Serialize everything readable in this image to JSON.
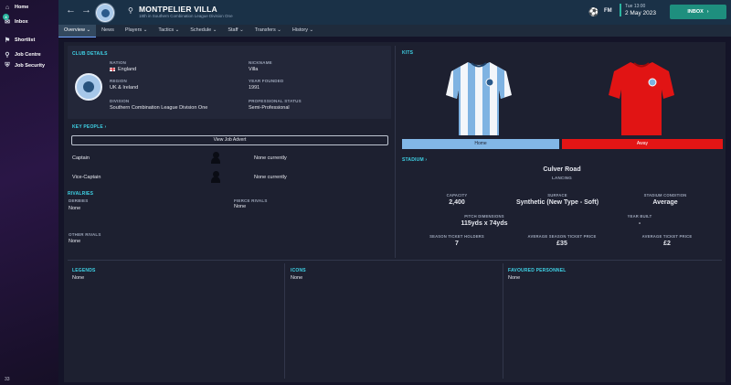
{
  "sidebar": {
    "items": [
      {
        "label": "Home",
        "icon": "home-icon"
      },
      {
        "label": "Inbox",
        "icon": "inbox-icon",
        "badge": "4"
      },
      {
        "label": "Shortlist",
        "icon": "shortlist-icon"
      },
      {
        "label": "Job Centre",
        "icon": "job-centre-icon"
      },
      {
        "label": "Job Security",
        "icon": "job-security-icon"
      }
    ],
    "bottom_number": "33"
  },
  "header": {
    "club_name": "MONTPELIER VILLA",
    "club_subtitle": "18th in Southern Combination League Division One",
    "date_day": "Tue 13:00",
    "date": "2 May 2023",
    "inbox_label": "INBOX",
    "fm_logo": "FM"
  },
  "tabs": [
    {
      "label": "Overview",
      "arrow": "⌄",
      "active": true
    },
    {
      "label": "News",
      "arrow": "",
      "active": false
    },
    {
      "label": "Players",
      "arrow": "⌄",
      "active": false
    },
    {
      "label": "Tactics",
      "arrow": "⌄",
      "active": false
    },
    {
      "label": "Schedule",
      "arrow": "⌄",
      "active": false
    },
    {
      "label": "Staff",
      "arrow": "⌄",
      "active": false
    },
    {
      "label": "Transfers",
      "arrow": "⌄",
      "active": false
    },
    {
      "label": "History",
      "arrow": "⌄",
      "active": false
    }
  ],
  "club_details": {
    "title": "CLUB DETAILS",
    "nation_label": "NATION",
    "nation": "England",
    "nickname_label": "NICKNAME",
    "nickname": "Villa",
    "region_label": "REGION",
    "region": "UK & Ireland",
    "founded_label": "YEAR FOUNDED",
    "founded": "1991",
    "division_label": "DIVISION",
    "division": "Southern Combination League Division One",
    "status_label": "PROFESSIONAL STATUS",
    "status": "Semi-Professional"
  },
  "key_people": {
    "title": "KEY PEOPLE",
    "view_advert": "View Job Advert",
    "captain_label": "Captain",
    "captain_value": "None currently",
    "vice_label": "Vice-Captain",
    "vice_value": "None currently"
  },
  "rivalries": {
    "title": "RIVALRIES",
    "derbies_label": "DERBIES",
    "derbies": "None",
    "fierce_label": "FIERCE RIVALS",
    "fierce": "None",
    "other_label": "OTHER RIVALS",
    "other": "None"
  },
  "kits": {
    "title": "KITS",
    "home_label": "Home",
    "away_label": "Away",
    "home_color": "#82b7e6",
    "away_color": "#e31515"
  },
  "stadium": {
    "title": "STADIUM",
    "name": "Culver Road",
    "location": "LANCING",
    "capacity_label": "CAPACITY",
    "capacity": "2,400",
    "surface_label": "SURFACE",
    "surface": "Synthetic (New Type - Soft)",
    "condition_label": "STADIUM CONDITION",
    "condition": "Average",
    "pitch_label": "PITCH DIMENSIONS",
    "pitch": "115yds x 74yds",
    "year_built_label": "YEAR BUILT",
    "year_built": "-",
    "holders_label": "SEASON TICKET HOLDERS",
    "holders": "7",
    "avg_season_label": "AVERAGE SEASON TICKET PRICE",
    "avg_season": "£35",
    "avg_ticket_label": "AVERAGE TICKET PRICE",
    "avg_ticket": "£2"
  },
  "bottom": {
    "legends_title": "LEGENDS",
    "legends": "None",
    "icons_title": "ICONS",
    "icons": "None",
    "favoured_title": "FAVOURED PERSONNEL",
    "favoured": "None"
  },
  "colors": {
    "accent": "#3fd2e6",
    "inbox": "#1e8f7e",
    "topbar": "#1a3147"
  }
}
